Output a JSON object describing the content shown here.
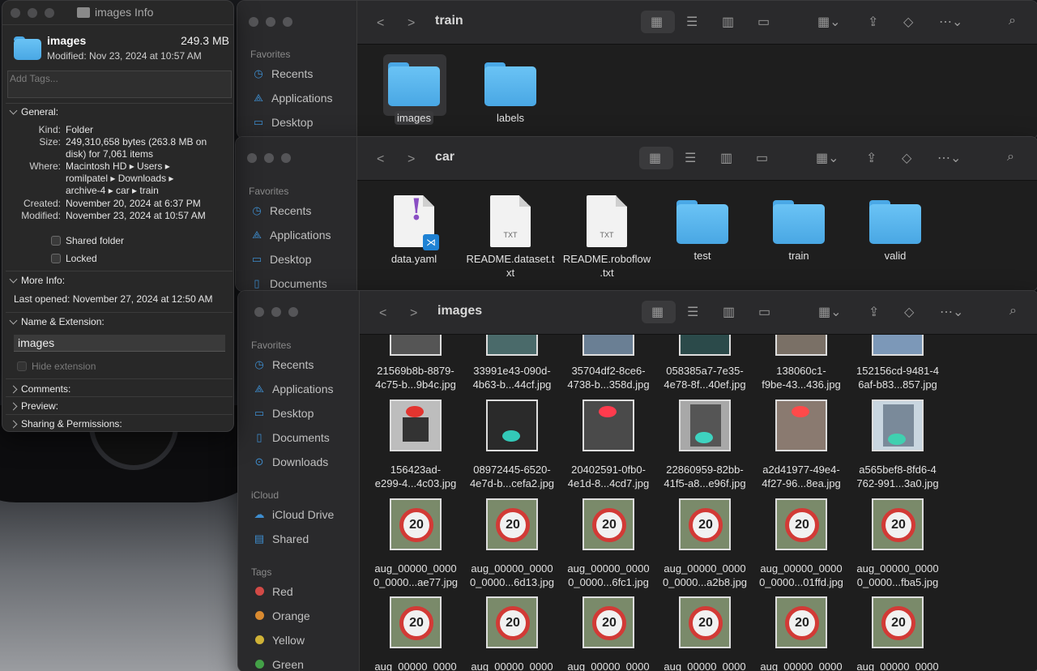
{
  "info": {
    "title": "images Info",
    "name": "images",
    "size": "249.3 MB",
    "modified_header": "Modified: Nov 23, 2024 at 10:57 AM",
    "tags_placeholder": "Add Tags...",
    "general_label": "General:",
    "kind_key": "Kind:",
    "kind_val": "Folder",
    "size_key": "Size:",
    "size_val_1": "249,310,658 bytes (263.8 MB on",
    "size_val_2": "disk) for 7,061 items",
    "where_key": "Where:",
    "where_1": "Macintosh HD ▸ Users ▸",
    "where_2": "romilpatel ▸ Downloads ▸",
    "where_3": "archive-4 ▸ car ▸ train",
    "created_key": "Created:",
    "created_val": "November 20, 2024 at 6:37 PM",
    "modified_key": "Modified:",
    "modified_val": "November 23, 2024 at 10:57 AM",
    "shared_folder": "Shared folder",
    "locked": "Locked",
    "more_info_label": "More Info:",
    "last_opened": "Last opened: November 27, 2024 at 12:50 AM",
    "name_ext_label": "Name & Extension:",
    "name_value": "images",
    "hide_extension": "Hide extension",
    "comments_label": "Comments:",
    "preview_label": "Preview:",
    "sharing_label": "Sharing & Permissions:"
  },
  "win_train": {
    "title": "train",
    "sidebar_header": "Favorites",
    "sidebar": [
      "Recents",
      "Applications",
      "Desktop"
    ],
    "items": [
      "images",
      "labels"
    ]
  },
  "win_car": {
    "title": "car",
    "sidebar_header": "Favorites",
    "sidebar": [
      "Recents",
      "Applications",
      "Desktop",
      "Documents"
    ],
    "items": {
      "data_yaml": "data.yaml",
      "readme_dataset_1": "README.dataset.t",
      "readme_dataset_2": "xt",
      "readme_roboflow_1": "README.roboflow",
      "readme_roboflow_2": ".txt",
      "test": "test",
      "train": "train",
      "valid": "valid"
    },
    "txt_badge": "TXT"
  },
  "win_images": {
    "title": "images",
    "favorites_header": "Favorites",
    "favorites": [
      "Recents",
      "Applications",
      "Desktop",
      "Documents",
      "Downloads"
    ],
    "icloud_header": "iCloud",
    "icloud": [
      "iCloud Drive",
      "Shared"
    ],
    "tags_header": "Tags",
    "tags": [
      {
        "label": "Red",
        "color": "#d24a46"
      },
      {
        "label": "Orange",
        "color": "#d98a30"
      },
      {
        "label": "Yellow",
        "color": "#cfb237"
      },
      {
        "label": "Green",
        "color": "#43a047"
      }
    ],
    "row1": [
      [
        "21569b8b-8879-",
        "4c75-b...9b4c.jpg"
      ],
      [
        "33991e43-090d-",
        "4b63-b...44cf.jpg"
      ],
      [
        "35704df2-8ce6-",
        "4738-b...358d.jpg"
      ],
      [
        "058385a7-7e35-",
        "4e78-8f...40ef.jpg"
      ],
      [
        "138060c1-",
        "f9be-43...436.jpg"
      ],
      [
        "152156cd-9481-4",
        "6af-b83...857.jpg"
      ]
    ],
    "row2": [
      [
        "156423ad-",
        "e299-4...4c03.jpg"
      ],
      [
        "08972445-6520-",
        "4e7d-b...cefa2.jpg"
      ],
      [
        "20402591-0fb0-",
        "4e1d-8...4cd7.jpg"
      ],
      [
        "22860959-82bb-",
        "41f5-a8...e96f.jpg"
      ],
      [
        "a2d41977-49e4-",
        "4f27-96...8ea.jpg"
      ],
      [
        "a565bef8-8fd6-4",
        "762-991...3a0.jpg"
      ]
    ],
    "row3": [
      [
        "aug_00000_0000",
        "0_0000...ae77.jpg"
      ],
      [
        "aug_00000_0000",
        "0_0000...6d13.jpg"
      ],
      [
        "aug_00000_0000",
        "0_0000...6fc1.jpg"
      ],
      [
        "aug_00000_0000",
        "0_0000...a2b8.jpg"
      ],
      [
        "aug_00000_0000",
        "0_0000...01ffd.jpg"
      ],
      [
        "aug_00000_0000",
        "0_0000...fba5.jpg"
      ]
    ],
    "row4": [
      "aug_00000_0000",
      "aug_00000_0000",
      "aug_00000_0000",
      "aug_00000_0000",
      "aug_00000_0000",
      "aug_00000_0000"
    ],
    "sign_text": "20"
  }
}
